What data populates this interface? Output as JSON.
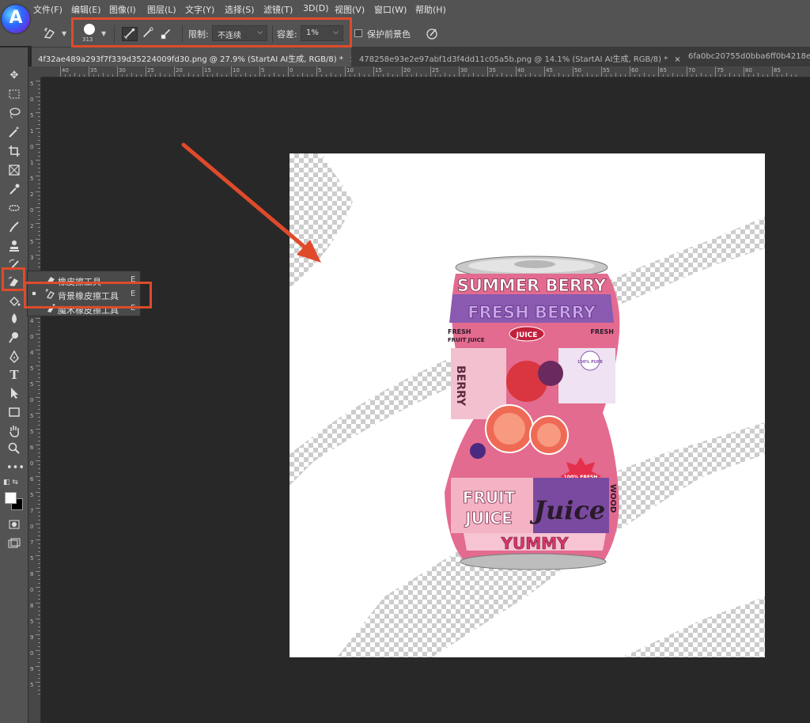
{
  "app": {
    "logo_letter": "A"
  },
  "menu": [
    "文件(F)",
    "编辑(E)",
    "图像(I)",
    "图层(L)",
    "文字(Y)",
    "选择(S)",
    "滤镜(T)",
    "3D(D)",
    "视图(V)",
    "窗口(W)",
    "帮助(H)"
  ],
  "options": {
    "brush_size": "313",
    "limit_label": "限制:",
    "limit_value": "不连续",
    "tolerance_label": "容差:",
    "tolerance_value": "1%",
    "protect_label": "保护前景色"
  },
  "tabs": [
    {
      "label": "4f32ae489a293f7f339d35224009fd30.png @ 27.9% (StartAI AI生成, RGB/8) *",
      "close": "×"
    },
    {
      "label": "478258e93e2e97abf1d3f4dd11c05a5b.png @ 14.1% (StartAI AI生成, RGB/8) *",
      "close": "×"
    },
    {
      "label": "6fa0bc20755d0bba6ff0b4218e",
      "close": ""
    }
  ],
  "ruler_top": [
    "40",
    "35",
    "30",
    "25",
    "20",
    "15",
    "10",
    "5",
    "0",
    "5",
    "10",
    "15",
    "20",
    "25",
    "30",
    "35",
    "40",
    "45",
    "50",
    "55",
    "60",
    "65",
    "70",
    "75",
    "80",
    "85"
  ],
  "ruler_left": [
    "5",
    "0",
    "5",
    "1",
    "0",
    "1",
    "5",
    "2",
    "0",
    "2",
    "5",
    "3",
    "0",
    "3",
    "5",
    "4",
    "0",
    "4",
    "5",
    "5",
    "0",
    "5",
    "5",
    "6",
    "0",
    "6",
    "5",
    "7",
    "0",
    "7",
    "5",
    "8",
    "0",
    "8",
    "5",
    "9",
    "0",
    "9",
    "5"
  ],
  "flyout": [
    {
      "label": "橡皮擦工具",
      "key": "E"
    },
    {
      "label": "背景橡皮擦工具",
      "key": "E"
    },
    {
      "label": "魔术橡皮擦工具",
      "key": "E"
    }
  ],
  "can": {
    "title1": "SUMMER BERRY",
    "title2": "FRESH BERRY",
    "fresh_fruit": "FRESH",
    "fruit_juice_small": "FRUIT JUICE",
    "juice_badge": "JUICE",
    "fresh_right": "FRESH",
    "pure": "100% PURE",
    "berry_vertical": "BERRY",
    "fresh_100": "100% FRESH",
    "fruit": "FRUIT",
    "juice_big": "JUICE",
    "juice_script": "Juice",
    "yummy": "YUMMY",
    "side": "WOOD"
  },
  "colors": {
    "highlight": "#e04a2a",
    "can_pink": "#e0608a",
    "can_purple": "#8a5ab0"
  }
}
